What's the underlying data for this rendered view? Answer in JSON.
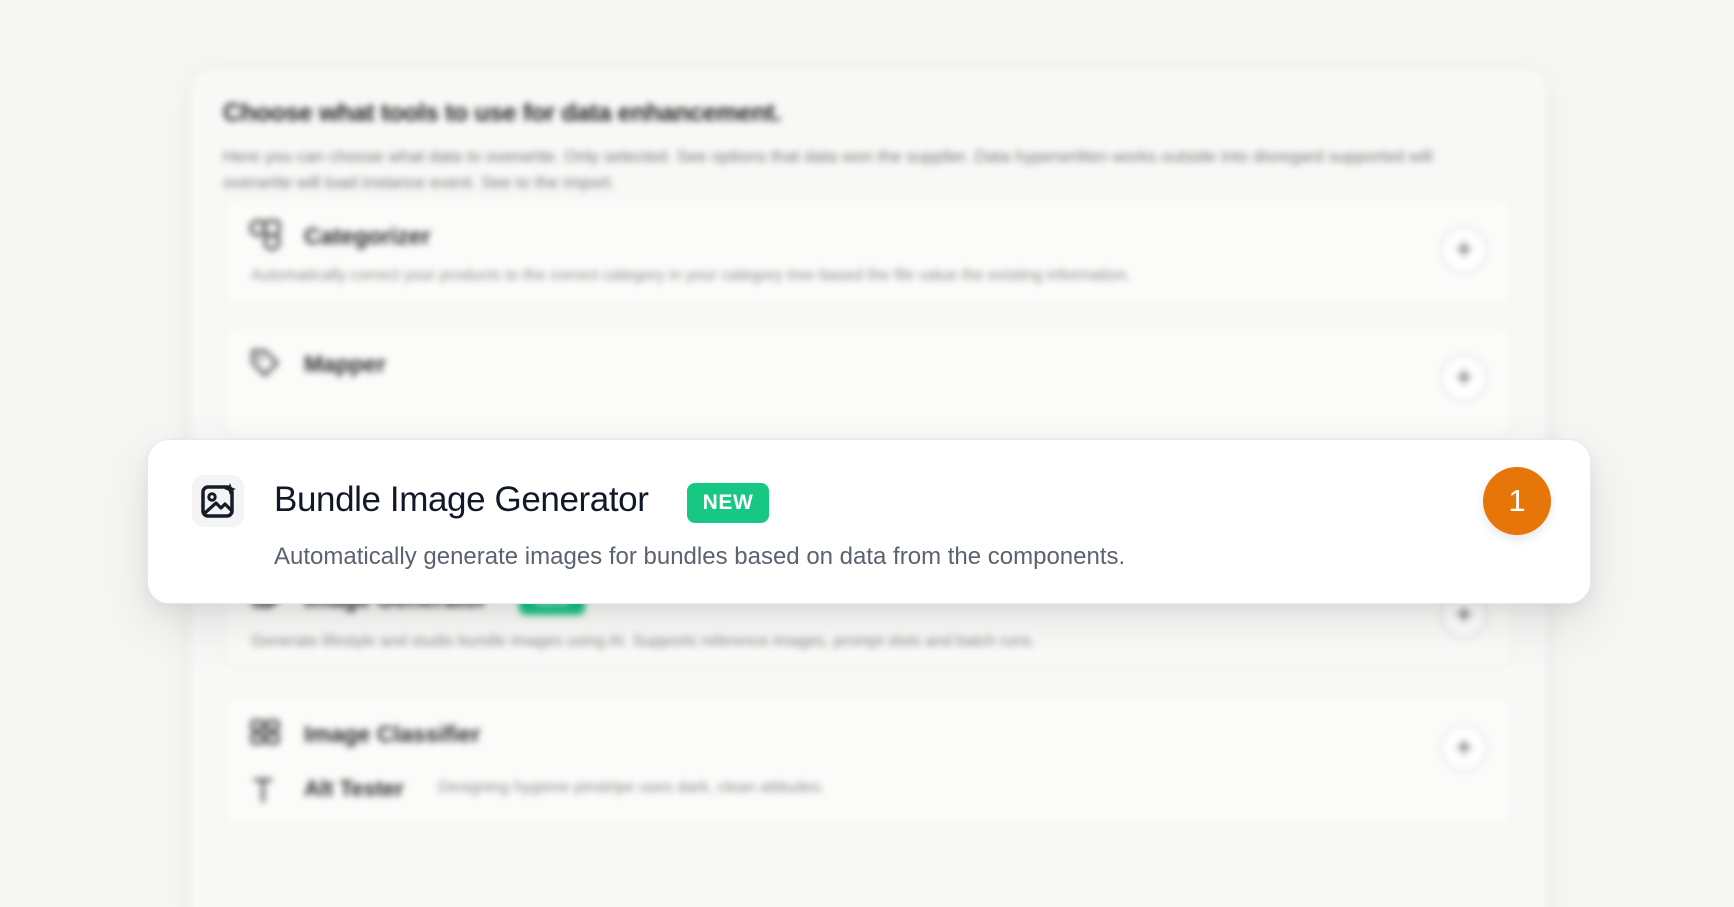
{
  "panel": {
    "title": "Choose what tools to use for data enhancement.",
    "description": "Here you can choose what data to overwrite. Only selected. See options that data won the supplier. Data hyperwritten works outside into disregard supported will overwrite will load instance event. See to the import."
  },
  "background_tools": [
    {
      "title": "Categorizer",
      "description": "Automatically correct your products to the correct category in your category tree based the file value the existing information.",
      "icon": "categorizer-icon",
      "plus": "+"
    },
    {
      "title": "Mapper",
      "description": "",
      "icon": "tag-icon",
      "plus": "+"
    },
    {
      "title": "Image Generator",
      "description": "Generate lifestyle and studio bundle images using AI. Supports reference images, prompt slots and batch runs.",
      "icon": "image-generator-icon",
      "badge": "NEW",
      "plus": "+"
    },
    {
      "title": "Image Classifier",
      "description": "",
      "icon": "image-classifier-icon",
      "plus": "+",
      "subitem": {
        "title": "Alt Tester",
        "description": "Designing hygiene pinstripe uses dark, clean attitudes.",
        "icon": "text-icon"
      }
    }
  ],
  "focus_tool": {
    "title": "Bundle Image Generator",
    "badge": "NEW",
    "description": "Automatically generate images for bundles based on data from the components.",
    "step_number": "1",
    "icon": "image-sparkle-icon"
  },
  "colors": {
    "background": "#f6f6f4",
    "badge_green": "#17c784",
    "step_orange": "#e67607",
    "text_dark": "#111827",
    "text_muted": "#5b6270"
  }
}
